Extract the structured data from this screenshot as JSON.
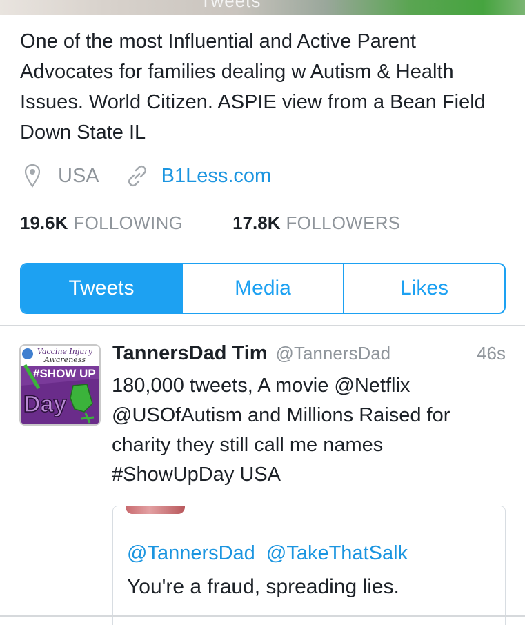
{
  "header": {
    "cropped_tab_label": "Tweets"
  },
  "profile": {
    "bio": "One of the most Influential and Active Parent Advocates for families dealing w Autism & Health Issues. World Citizen. ASPIE view from a Bean Field Down State IL",
    "location": "USA",
    "website": "B1Less.com",
    "location_icon": "map-pin-icon",
    "website_icon": "link-icon",
    "stats": [
      {
        "count": "19.6K",
        "label": "FOLLOWING"
      },
      {
        "count": "17.8K",
        "label": "FOLLOWERS"
      }
    ]
  },
  "tabs": [
    {
      "label": "Tweets",
      "active": true
    },
    {
      "label": "Media",
      "active": false
    },
    {
      "label": "Likes",
      "active": false
    }
  ],
  "tweet": {
    "avatar_text": {
      "line1": "Vaccine Injury",
      "line2": "Awareness",
      "line3": "#SHOW UP",
      "line4": "Day"
    },
    "display_name": "TannersDad Tim",
    "username": "@TannersDad",
    "timestamp": "46s",
    "text": "180,000 tweets, A movie @Netflix @USOfAutism and Millions Raised for charity they still call me names #ShowUpDay USA",
    "quote": {
      "mention_1": "@TannersDad",
      "mention_2": "@TakeThatSalk",
      "text": "You're a fraud, spreading lies."
    }
  },
  "colors": {
    "accent": "#1da1f2",
    "link": "#1b95e0",
    "muted": "#8f959b",
    "text": "#1c2127"
  }
}
